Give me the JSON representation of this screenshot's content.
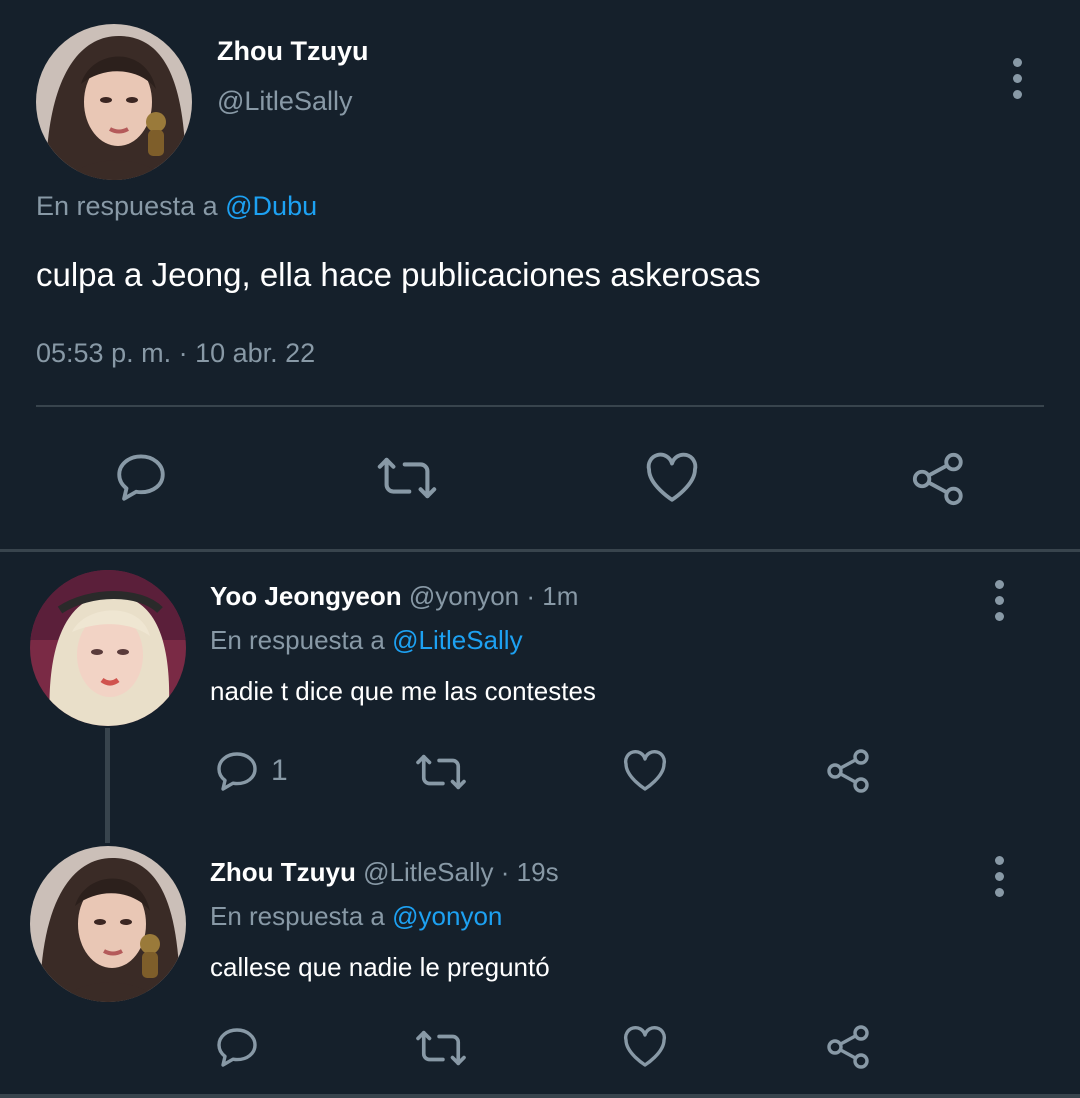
{
  "main_tweet": {
    "author_name": "Zhou Tzuyu",
    "author_handle": "@LitleSally",
    "reply_prefix": "En respuesta a",
    "reply_mention": "@Dubu",
    "text": "culpa a Jeong, ella hace publicaciones askerosas",
    "timestamp": "05:53 p. m. · 10 abr. 22",
    "actions": [
      "reply-icon",
      "retweet-icon",
      "like-icon",
      "share-icon"
    ]
  },
  "replies": [
    {
      "author_name": "Yoo Jeongyeon",
      "meta": "@yonyon · 1m",
      "reply_prefix": "En respuesta a",
      "reply_mention": "@LitleSally",
      "text": "nadie t dice que me las contestes",
      "reply_count": "1"
    },
    {
      "author_name": "Zhou Tzuyu",
      "meta": "@LitleSally · 19s",
      "reply_prefix": "En respuesta a",
      "reply_mention": "@yonyon",
      "text": "callese que nadie le preguntó",
      "reply_count": ""
    }
  ],
  "colors": {
    "background": "#15202b",
    "secondary_text": "#8899a6",
    "mention": "#1da1f2",
    "divider": "#38444d"
  }
}
